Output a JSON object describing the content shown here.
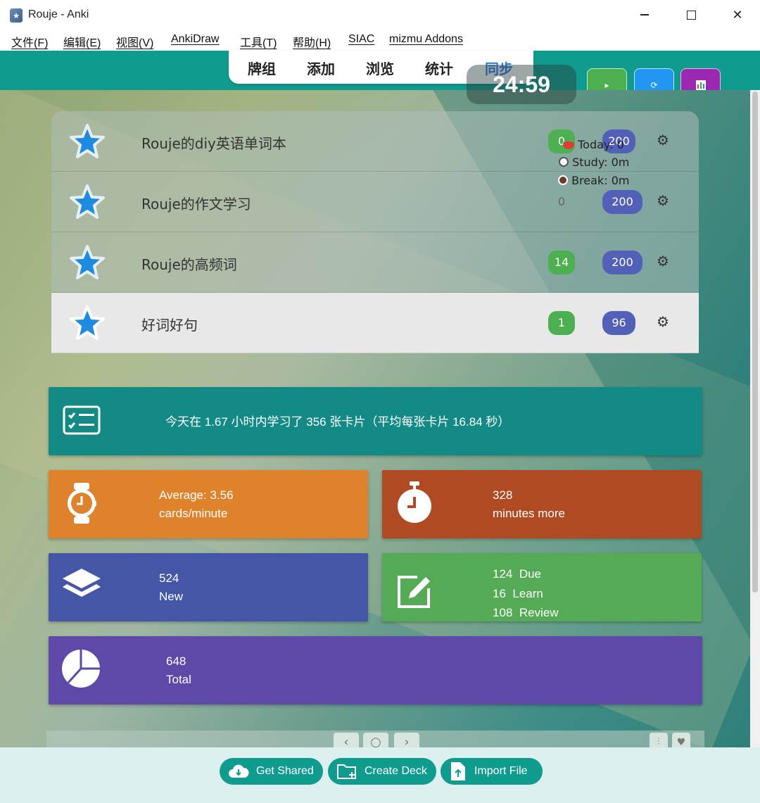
{
  "window": {
    "title": "Rouje - Anki"
  },
  "menu": [
    "文件(F)",
    "编辑(E)",
    "视图(V)",
    "AnkiDraw",
    "工具(T)",
    "帮助(H)",
    "SIAC",
    "mizmu Addons"
  ],
  "nav": {
    "decks": "牌组",
    "add": "添加",
    "browse": "浏览",
    "stats": "统计",
    "sync": "同步"
  },
  "timer": "24:59",
  "toolbar_buttons": {
    "play": "▸",
    "refresh": "⟳",
    "stats": "stats-icon"
  },
  "decks": [
    {
      "name": "Rouje的diy英语单词本",
      "new": "0",
      "review": "200"
    },
    {
      "name": "Rouje的作文学习",
      "new": "0",
      "review": "200"
    },
    {
      "name": "Rouje的高频词",
      "new": "14",
      "review": "200"
    },
    {
      "name": "好词好句",
      "new": "1",
      "review": "96"
    }
  ],
  "pomodoro": {
    "today": "Today: 0",
    "study": "Study: 0m",
    "break": "Break: 0m"
  },
  "summary": "今天在 1.67 小时内学习了 356 张卡片（平均每张卡片 16.84 秒）",
  "cards": {
    "average": {
      "line1": "Average: 3.56",
      "line2": "cards/minute"
    },
    "more": {
      "line1": "328",
      "line2": "minutes more"
    },
    "new": {
      "line1": "524",
      "line2": "New"
    },
    "due": {
      "due_n": "124",
      "due_l": "Due",
      "learn_n": "16",
      "learn_l": "Learn",
      "review_n": "108",
      "review_l": "Review"
    },
    "total": {
      "line1": "648",
      "line2": "Total"
    }
  },
  "pager": {
    "prev": "‹",
    "home": "○",
    "next": "›"
  },
  "bottom": {
    "get_shared": "Get Shared",
    "create_deck": "Create Deck",
    "import_file": "Import File"
  },
  "colors": {
    "teal": "#0f9c8f",
    "summary": "#138a85",
    "orange": "#de832c",
    "rust": "#b04a22",
    "indigo": "#4656a6",
    "green": "#55aa55",
    "purple": "#5e48a8"
  }
}
